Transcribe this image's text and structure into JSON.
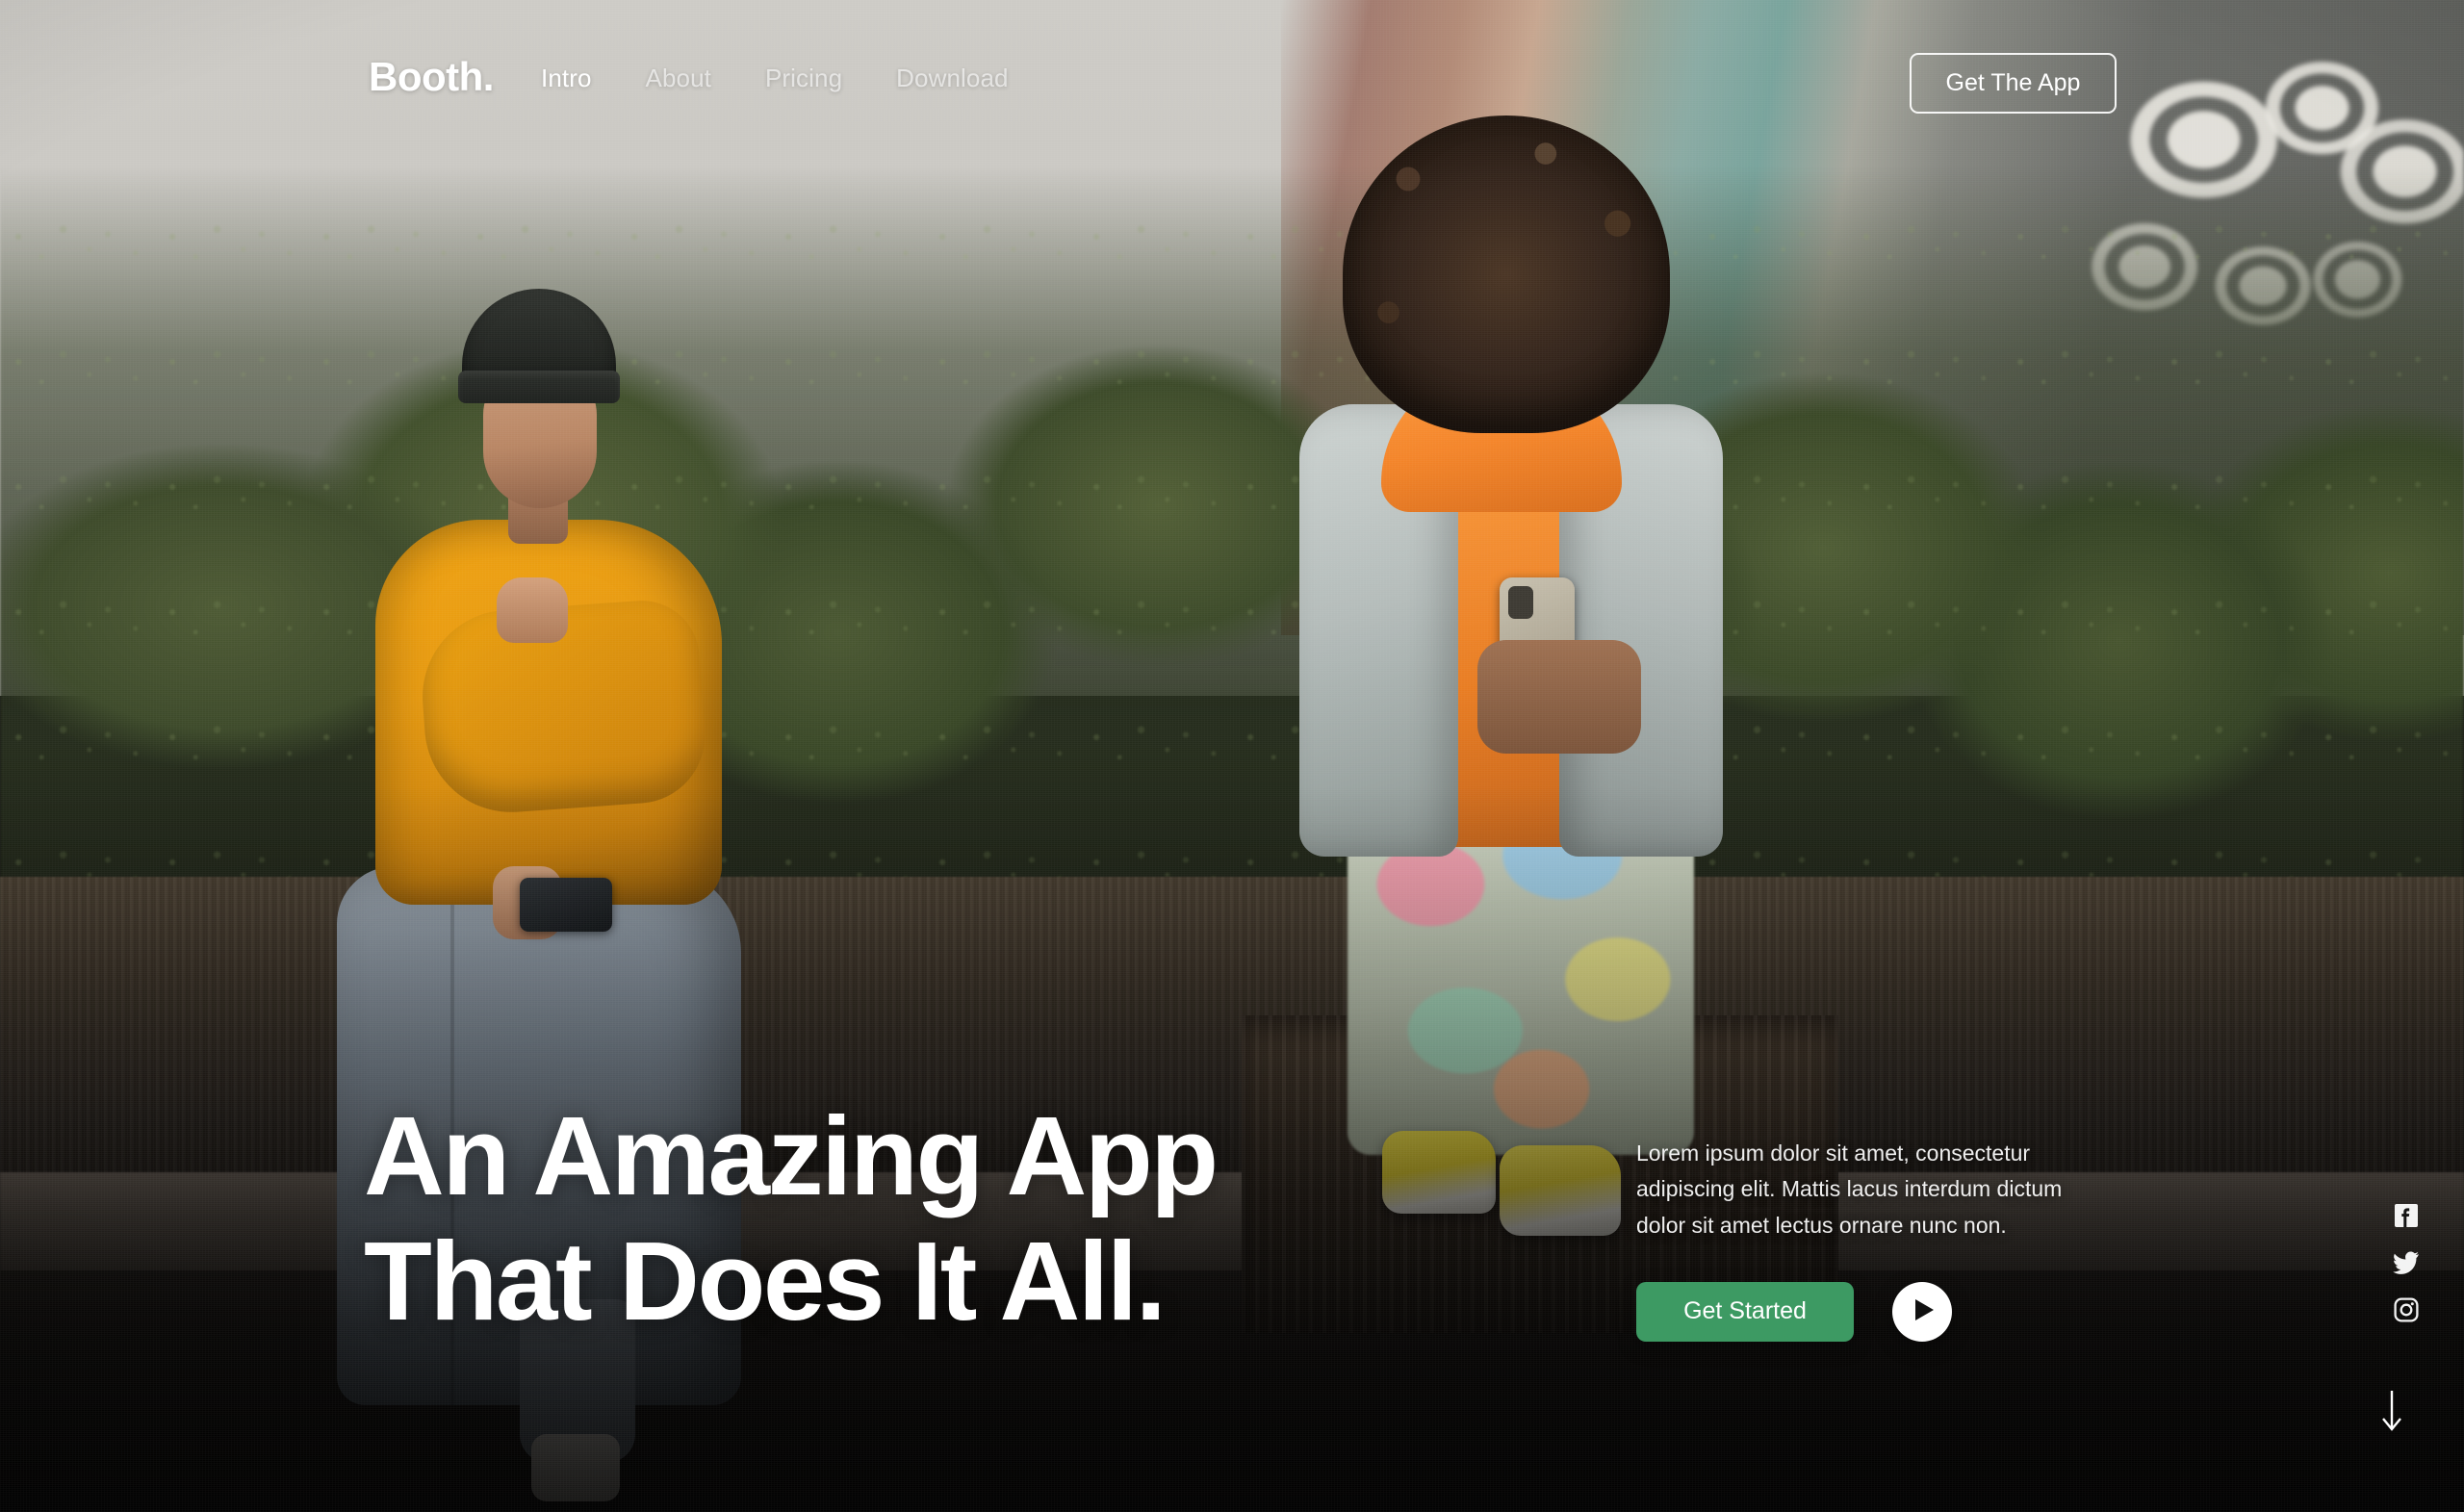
{
  "site": {
    "brand": "Booth."
  },
  "header": {
    "nav": [
      {
        "label": "Intro",
        "active": true
      },
      {
        "label": "About",
        "active": false
      },
      {
        "label": "Pricing",
        "active": false
      },
      {
        "label": "Download",
        "active": false
      }
    ],
    "cta_label": "Get The App"
  },
  "hero": {
    "title": "An Amazing App\nThat Does It All.",
    "paragraph": "Lorem ipsum dolor sit amet, consectetur adipiscing elit. Mattis lacus interdum dictum dolor sit amet lectus ornare nunc non.",
    "primary_button": "Get Started",
    "play_button_label": "play-video"
  },
  "social": [
    {
      "name": "facebook-icon",
      "label": "Facebook"
    },
    {
      "name": "twitter-icon",
      "label": "Twitter"
    },
    {
      "name": "instagram-icon",
      "label": "Instagram"
    }
  ],
  "scroll_indicator": {
    "name": "scroll-down-arrow-icon",
    "label": "Scroll down"
  },
  "colors": {
    "accent_green": "#3d9a63",
    "text_on_image": "#ffffff",
    "nav_inactive": "rgba(255,255,255,0.62)",
    "sky": "#cdcbc6"
  },
  "background": {
    "description": "Photograph of a young man in an orange sweatshirt and black beanie and a woman in an orange hoodie and denim jacket sitting on a wooden bench outdoors, both looking at smartphones, with hedges and a graffiti wall behind them."
  }
}
